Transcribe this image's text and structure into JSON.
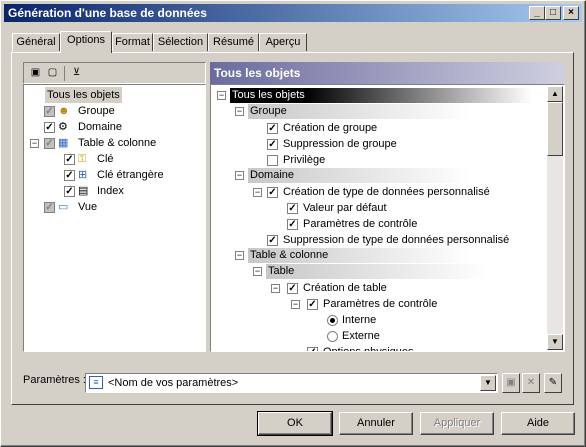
{
  "window": {
    "title": "Génération d'une base de données"
  },
  "titlebar_buttons": [
    "_",
    "□",
    "×"
  ],
  "tabs": [
    "Général",
    "Options",
    "Format",
    "Sélection",
    "Résumé",
    "Aperçu"
  ],
  "active_tab": "Options",
  "left_tree": {
    "root": "Tous les objets",
    "items": [
      {
        "label": "Groupe",
        "checked": "grey"
      },
      {
        "label": "Domaine",
        "checked": "yes"
      },
      {
        "label": "Table & colonne",
        "checked": "grey"
      },
      {
        "label": "Clé",
        "checked": "yes"
      },
      {
        "label": "Clé étrangère",
        "checked": "yes"
      },
      {
        "label": "Index",
        "checked": "yes"
      },
      {
        "label": "Vue",
        "checked": "grey"
      }
    ]
  },
  "right_tree": {
    "header": "Tous les objets",
    "root": "Tous les objets",
    "rows": [
      {
        "kind": "group",
        "label": "Groupe"
      },
      {
        "kind": "check",
        "label": "Création de groupe",
        "checked": true
      },
      {
        "kind": "check",
        "label": "Suppression de groupe",
        "checked": true
      },
      {
        "kind": "check",
        "label": "Privilège",
        "checked": false
      },
      {
        "kind": "group",
        "label": "Domaine"
      },
      {
        "kind": "check",
        "label": "Création de type de données personnalisé",
        "checked": true
      },
      {
        "kind": "check",
        "label": "Valeur par défaut",
        "checked": true
      },
      {
        "kind": "check",
        "label": "Paramètres de contrôle",
        "checked": true
      },
      {
        "kind": "check",
        "label": "Suppression de type de données personnalisé",
        "checked": true
      },
      {
        "kind": "group",
        "label": "Table & colonne"
      },
      {
        "kind": "group",
        "label": "Table"
      },
      {
        "kind": "check",
        "label": "Création de table",
        "checked": true
      },
      {
        "kind": "check",
        "label": "Paramètres de contrôle",
        "checked": true
      },
      {
        "kind": "radio",
        "label": "Interne",
        "selected": true
      },
      {
        "kind": "radio",
        "label": "Externe",
        "selected": false
      },
      {
        "kind": "check",
        "label": "Options physiques",
        "checked": true
      }
    ]
  },
  "params": {
    "label": "Paramètres :",
    "value": "<Nom de vos paramètres>"
  },
  "buttons": {
    "ok": "OK",
    "cancel": "Annuler",
    "apply": "Appliquer",
    "help": "Aide"
  }
}
